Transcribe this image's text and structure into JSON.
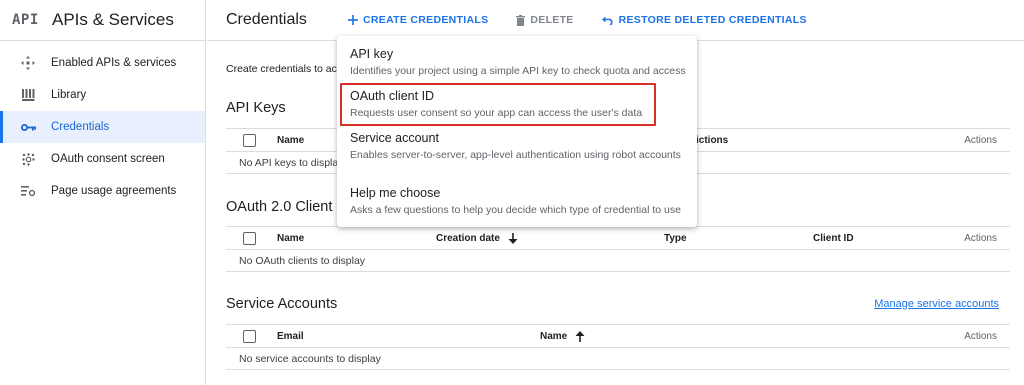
{
  "sidebar": {
    "logo": "API",
    "title": "APIs & Services",
    "items": [
      {
        "label": "Enabled APIs & services",
        "icon": "diamond-arrows-icon"
      },
      {
        "label": "Library",
        "icon": "library-icon"
      },
      {
        "label": "Credentials",
        "icon": "key-icon",
        "active": true
      },
      {
        "label": "OAuth consent screen",
        "icon": "consent-dots-icon"
      },
      {
        "label": "Page usage agreements",
        "icon": "settings-list-icon"
      }
    ]
  },
  "topbar": {
    "title": "Credentials",
    "create_label": "CREATE CREDENTIALS",
    "delete_label": "DELETE",
    "restore_label": "RESTORE DELETED CREDENTIALS"
  },
  "main": {
    "intro": "Create credentials to acc",
    "api_keys": {
      "title": "API Keys",
      "columns": [
        "Name",
        "ictions",
        "Actions"
      ],
      "empty": "No API keys to displa"
    },
    "oauth": {
      "title": "OAuth 2.0 Client I",
      "columns": [
        "Name",
        "Creation date",
        "Type",
        "Client ID",
        "Actions"
      ],
      "empty": "No OAuth clients to display"
    },
    "service_accounts": {
      "title": "Service Accounts",
      "manage_link": "Manage service accounts",
      "columns": [
        "Email",
        "Name",
        "Actions"
      ],
      "empty": "No service accounts to display"
    }
  },
  "dropdown": {
    "items": [
      {
        "title": "API key",
        "desc": "Identifies your project using a simple API key to check quota and access"
      },
      {
        "title": "OAuth client ID",
        "desc": "Requests user consent so your app can access the user's data"
      },
      {
        "title": "Service account",
        "desc": "Enables server-to-server, app-level authentication using robot accounts"
      },
      {
        "title": "Help me choose",
        "desc": "Asks a few questions to help you decide which type of credential to use"
      }
    ]
  },
  "colors": {
    "accent": "#1a73e8",
    "active_bg": "#e8f0fe",
    "highlight_border": "#d93025",
    "divider": "#dadce0"
  }
}
